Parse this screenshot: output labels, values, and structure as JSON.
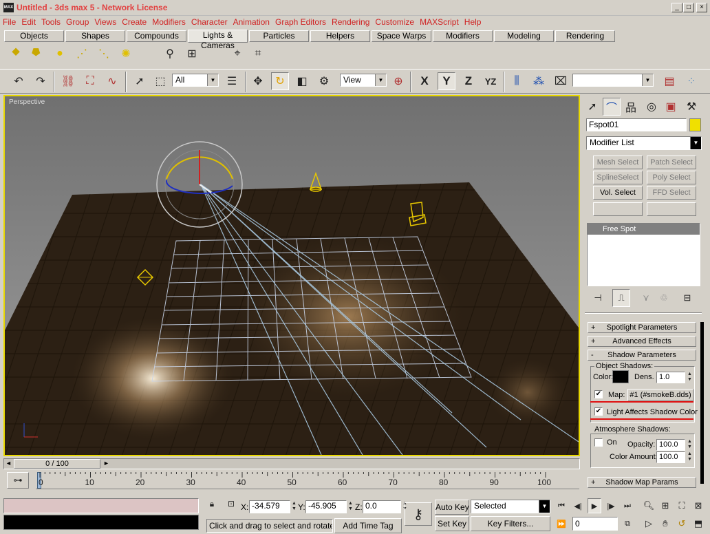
{
  "titlebar": {
    "app_icon": "MAX",
    "title": "Untitled - 3ds max 5 - Network License"
  },
  "menu": [
    "File",
    "Edit",
    "Tools",
    "Group",
    "Views",
    "Create",
    "Modifiers",
    "Character",
    "Animation",
    "Graph Editors",
    "Rendering",
    "Customize",
    "MAXScript",
    "Help"
  ],
  "tabs": [
    "Objects",
    "Shapes",
    "Compounds",
    "Lights & Cameras",
    "Particles",
    "Helpers",
    "Space Warps",
    "Modifiers",
    "Modeling",
    "Rendering"
  ],
  "toolbar": {
    "selection_filter": "All",
    "ref_coord": "View",
    "axis_x": "X",
    "axis_y": "Y",
    "axis_z": "Z",
    "axis_yz": "YZ",
    "named_selection": ""
  },
  "viewport": {
    "label": "Perspective"
  },
  "panel": {
    "object_name": "Fspot01",
    "object_color": "#f0e000",
    "modifier_list": "Modifier List",
    "buttons": [
      {
        "label": "Mesh Select",
        "on": false
      },
      {
        "label": "Patch Select",
        "on": false
      },
      {
        "label": "SplineSelect",
        "on": false
      },
      {
        "label": "Poly Select",
        "on": false
      },
      {
        "label": "Vol. Select",
        "on": true
      },
      {
        "label": "FFD Select",
        "on": false
      }
    ],
    "stack_item": "Free Spot",
    "rollouts": {
      "spotlight": "Spotlight Parameters",
      "advanced": "Advanced Effects",
      "shadow": "Shadow Parameters",
      "shadowmap": "Shadow Map Params"
    },
    "rollout_signs": {
      "closed": "+",
      "open": "-"
    },
    "object_shadows": {
      "group": "Object Shadows:",
      "color_label": "Color:",
      "dens_label": "Dens.",
      "dens_value": "1.0",
      "map_label": "Map:",
      "map_value": "#1 (#smokeB.dds)",
      "light_affects": "Light Affects Shadow Color"
    },
    "atmosphere": {
      "group": "Atmosphere Shadows:",
      "on_label": "On",
      "opacity_label": "Opacity:",
      "opacity_value": "100.0",
      "coloramount_label": "Color Amount:",
      "coloramount_value": "100.0"
    }
  },
  "timeline": {
    "slider": "0 / 100",
    "ticks": [
      "0",
      "10",
      "20",
      "30",
      "40",
      "50",
      "60",
      "70",
      "80",
      "90",
      "100"
    ]
  },
  "status": {
    "x_label": "X:",
    "x": "-34.579",
    "y_label": "Y:",
    "y": "-45.905",
    "z_label": "Z:",
    "z": "0.0",
    "prompt": "Click and drag to select and rotate ob",
    "add_time_tag": "Add Time Tag",
    "auto_key": "Auto Key",
    "set_key": "Set Key",
    "selected": "Selected",
    "key_filters": "Key Filters...",
    "frame": "0"
  }
}
